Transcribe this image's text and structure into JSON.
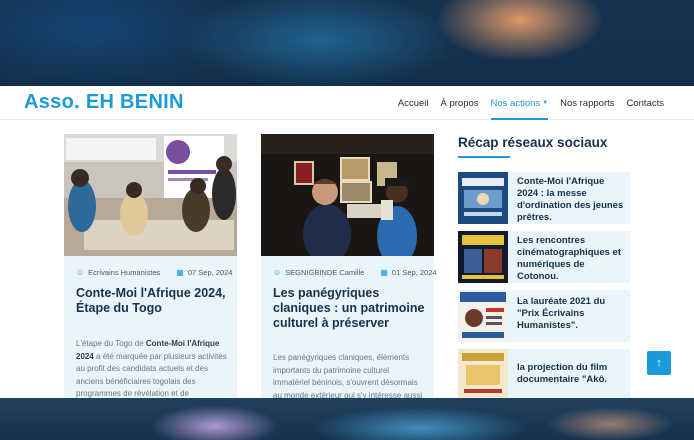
{
  "brand": {
    "name": "Asso. EH BENIN"
  },
  "nav": {
    "items": [
      {
        "label": "Accueil"
      },
      {
        "label": "À propos"
      },
      {
        "label": "Nos actions"
      },
      {
        "label": "Nos rapports"
      },
      {
        "label": "Contacts"
      }
    ],
    "active": "Nos actions"
  },
  "posts": [
    {
      "author": "Ecrivains Humanistes",
      "date": "07 Sep, 2024",
      "title": "Conte-Moi l'Afrique 2024, Étape du Togo",
      "excerpt_intro": "L'étape du Togo de ",
      "excerpt_bold": "Conte-Moi l'Afrique 2024",
      "excerpt_rest": " a été marquée par plusieurs activités au profit des candidats actuels et des anciens bénéficiaires togolais des programmes de révélation et de valorisation des"
    },
    {
      "author": "SEGNIGBINDE Camille",
      "date": "01 Sep, 2024",
      "title": "Les panégyriques claniques : un patrimoine culturel à préserver",
      "excerpt_intro": "Les panégyriques claniques, éléments importants du patrimoine culturel immatériel béninois, s'ouvrent désormais au monde extérieur qui s'y intéresse aussi énormément.",
      "excerpt_bold": "",
      "excerpt_rest": ""
    }
  ],
  "sidebar": {
    "title": "Récap réseaux sociaux",
    "items": [
      {
        "text": "Conte-Moi l'Afrique 2024 : la messe d'ordination des jeunes prêtres."
      },
      {
        "text": "Les rencontres cinématographiques et numériques de Cotonou."
      },
      {
        "text": "La lauréate 2021 du \"Prix Écrivains Humanistes\"."
      },
      {
        "text": "la projection du film documentaire \"Akô."
      }
    ]
  },
  "colors": {
    "accent": "#1a9ad8",
    "heading": "#17324a",
    "card_bg": "#e9f4fb"
  },
  "icons": {
    "author": "user-icon",
    "date": "calendar-icon",
    "back_to_top": "arrow-up-icon"
  }
}
